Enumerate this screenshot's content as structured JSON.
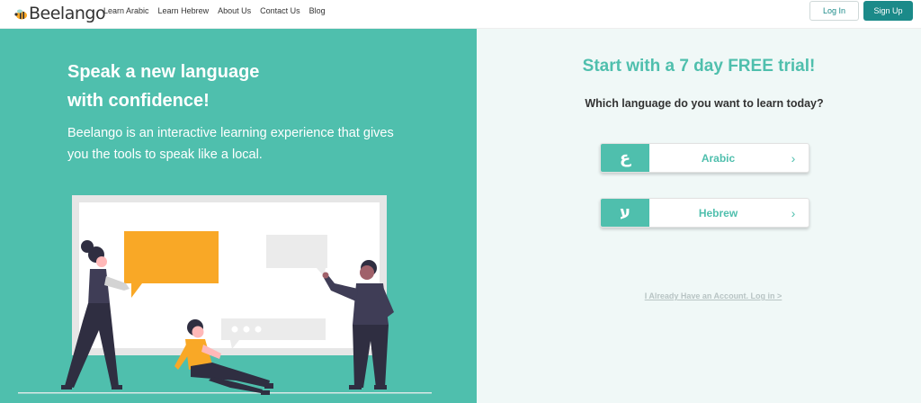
{
  "brand": {
    "logo_text": "Beelango",
    "logo_icon": "bee-icon"
  },
  "nav": {
    "items": [
      {
        "label": "Learn Arabic"
      },
      {
        "label": "Learn Hebrew"
      },
      {
        "label": "About Us"
      },
      {
        "label": "Contact Us"
      },
      {
        "label": "Blog"
      }
    ]
  },
  "header": {
    "login_label": "Log In",
    "signup_label": "Sign Up"
  },
  "hero": {
    "headline_line1": "Speak a new language",
    "headline_line2": "with confidence!",
    "subtext": "Beelango is an interactive learning experience that gives you the tools to speak like a local."
  },
  "trial": {
    "title": "Start with a 7 day FREE trial!",
    "question": "Which language do you want to learn today?",
    "languages": [
      {
        "glyph": "ع",
        "name": "Arabic",
        "chevron": "›"
      },
      {
        "glyph": "ע",
        "name": "Hebrew",
        "chevron": "›"
      }
    ],
    "account_link": "I Already Have an Account. Log in >"
  },
  "colors": {
    "teal": "#4fbfad",
    "dark_teal": "#1b8a89",
    "panel_bg": "#f0f8f7",
    "bubble_orange": "#f9a826"
  }
}
